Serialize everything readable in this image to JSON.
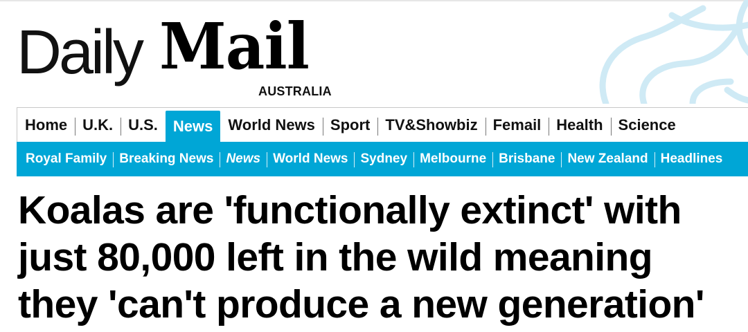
{
  "masthead": {
    "logo_part1": "Daily",
    "logo_part2": "Mail",
    "edition": "AUSTRALIA"
  },
  "nav_primary": [
    {
      "label": "Home",
      "active": false
    },
    {
      "label": "U.K.",
      "active": false
    },
    {
      "label": "U.S.",
      "active": false
    },
    {
      "label": "News",
      "active": true
    },
    {
      "label": "World News",
      "active": false
    },
    {
      "label": "Sport",
      "active": false
    },
    {
      "label": "TV&Showbiz",
      "active": false
    },
    {
      "label": "Femail",
      "active": false
    },
    {
      "label": "Health",
      "active": false
    },
    {
      "label": "Science",
      "active": false
    }
  ],
  "nav_secondary": [
    {
      "label": "Royal Family",
      "active": false
    },
    {
      "label": "Breaking News",
      "active": false
    },
    {
      "label": "News",
      "active": true
    },
    {
      "label": "World News",
      "active": false
    },
    {
      "label": "Sydney",
      "active": false
    },
    {
      "label": "Melbourne",
      "active": false
    },
    {
      "label": "Brisbane",
      "active": false
    },
    {
      "label": "New Zealand",
      "active": false
    },
    {
      "label": "Headlines",
      "active": false
    }
  ],
  "article": {
    "headline": "Koalas are 'functionally extinct' with just 80,000 left in the wild meaning they 'can't produce a new generation'"
  },
  "colors": {
    "accent": "#00a6d6",
    "text": "#000000",
    "decoration": "#cfeaf5"
  },
  "icons": {
    "masthead_decoration": "koala-outline-decoration"
  }
}
